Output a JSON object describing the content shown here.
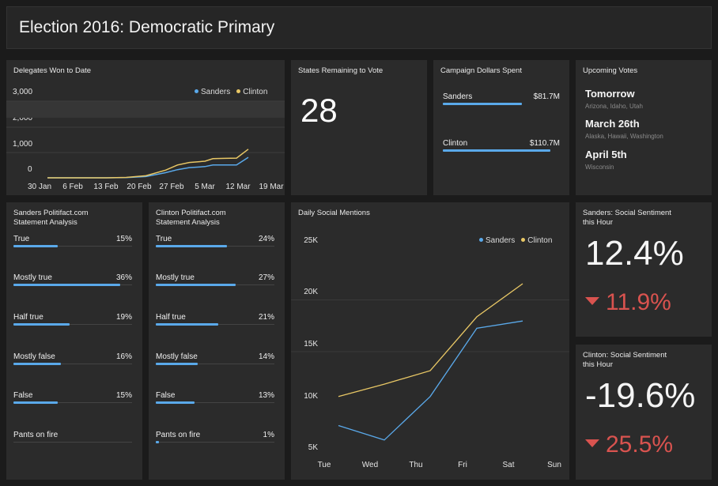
{
  "header": {
    "title": "Election 2016: Democratic Primary"
  },
  "colors": {
    "sanders": "#5aa9ea",
    "clinton": "#e8c765",
    "negative": "#d9534f"
  },
  "delegates": {
    "title": "Delegates Won to Date",
    "legend": [
      "Sanders",
      "Clinton"
    ],
    "y_ticks": [
      "3,000",
      "2,000",
      "1,000",
      "0"
    ],
    "x_ticks": [
      "30 Jan",
      "6 Feb",
      "13 Feb",
      "20 Feb",
      "27 Feb",
      "5 Mar",
      "12 Mar",
      "19 Mar"
    ]
  },
  "states": {
    "title": "States Remaining to Vote",
    "value": "28"
  },
  "campaign": {
    "title": "Campaign Dollars Spent",
    "items": [
      {
        "name": "Sanders",
        "amount": "$81.7M",
        "fraction": 0.738
      },
      {
        "name": "Clinton",
        "amount": "$110.7M",
        "fraction": 1.0
      }
    ]
  },
  "upcoming": {
    "title": "Upcoming Votes",
    "items": [
      {
        "when": "Tomorrow",
        "states": "Arizona, Idaho, Utah"
      },
      {
        "when": "March 26th",
        "states": "Alaska, Hawaii, Washington"
      },
      {
        "when": "April 5th",
        "states": "Wisconsin"
      }
    ]
  },
  "sanders_politifact": {
    "title": "Sanders Politifact.com\nStatement Analysis",
    "rows": [
      {
        "label": "True",
        "pct": "15%",
        "value": 15
      },
      {
        "label": "Mostly true",
        "pct": "36%",
        "value": 36
      },
      {
        "label": "Half true",
        "pct": "19%",
        "value": 19
      },
      {
        "label": "Mostly false",
        "pct": "16%",
        "value": 16
      },
      {
        "label": "False",
        "pct": "15%",
        "value": 15
      },
      {
        "label": "Pants on fire",
        "pct": "",
        "value": 0
      }
    ]
  },
  "clinton_politifact": {
    "title": "Clinton Politifact.com\nStatement Analysis",
    "rows": [
      {
        "label": "True",
        "pct": "24%",
        "value": 24
      },
      {
        "label": "Mostly true",
        "pct": "27%",
        "value": 27
      },
      {
        "label": "Half true",
        "pct": "21%",
        "value": 21
      },
      {
        "label": "Mostly false",
        "pct": "14%",
        "value": 14
      },
      {
        "label": "False",
        "pct": "13%",
        "value": 13
      },
      {
        "label": "Pants on fire",
        "pct": "1%",
        "value": 1
      }
    ]
  },
  "social": {
    "title": "Daily Social Mentions",
    "legend": [
      "Sanders",
      "Clinton"
    ],
    "y_ticks": [
      "25K",
      "20K",
      "15K",
      "10K",
      "5K"
    ],
    "x_ticks": [
      "Tue",
      "Wed",
      "Thu",
      "Fri",
      "Sat",
      "Sun"
    ]
  },
  "sanders_sentiment": {
    "title": "Sanders: Social Sentiment\nthis Hour",
    "value": "12.4%",
    "delta": "11.9%"
  },
  "clinton_sentiment": {
    "title": "Clinton: Social Sentiment\nthis Hour",
    "value": "-19.6%",
    "delta": "25.5%"
  },
  "chart_data": [
    {
      "type": "line",
      "title": "Delegates Won to Date",
      "x": [
        "30 Jan",
        "6 Feb",
        "13 Feb",
        "20 Feb",
        "27 Feb",
        "5 Mar",
        "12 Mar",
        "19 Mar"
      ],
      "ylim": [
        0,
        3000
      ],
      "series": [
        {
          "name": "Sanders",
          "points": [
            [
              0,
              0
            ],
            [
              5,
              0
            ],
            [
              10,
              0
            ],
            [
              15,
              0
            ],
            [
              20,
              5
            ],
            [
              25,
              50
            ],
            [
              30,
              200
            ],
            [
              33,
              320
            ],
            [
              36,
              400
            ],
            [
              40,
              440
            ],
            [
              42,
              500
            ],
            [
              45,
              500
            ],
            [
              48,
              500
            ],
            [
              51,
              800
            ]
          ]
        },
        {
          "name": "Clinton",
          "points": [
            [
              0,
              0
            ],
            [
              5,
              0
            ],
            [
              10,
              0
            ],
            [
              15,
              0
            ],
            [
              20,
              15
            ],
            [
              25,
              80
            ],
            [
              30,
              300
            ],
            [
              33,
              500
            ],
            [
              36,
              600
            ],
            [
              40,
              650
            ],
            [
              42,
              750
            ],
            [
              45,
              760
            ],
            [
              48,
              770
            ],
            [
              51,
              1120
            ]
          ]
        }
      ]
    },
    {
      "type": "line",
      "title": "Daily Social Mentions",
      "categories": [
        "Tue",
        "Wed",
        "Thu",
        "Fri",
        "Sat",
        "Sun"
      ],
      "ylim": [
        5000,
        25000
      ],
      "series": [
        {
          "name": "Sanders",
          "values": [
            7100,
            5700,
            9900,
            16500,
            17200,
            null
          ]
        },
        {
          "name": "Clinton",
          "values": [
            9900,
            11100,
            12400,
            17600,
            20800,
            null
          ]
        }
      ]
    }
  ]
}
